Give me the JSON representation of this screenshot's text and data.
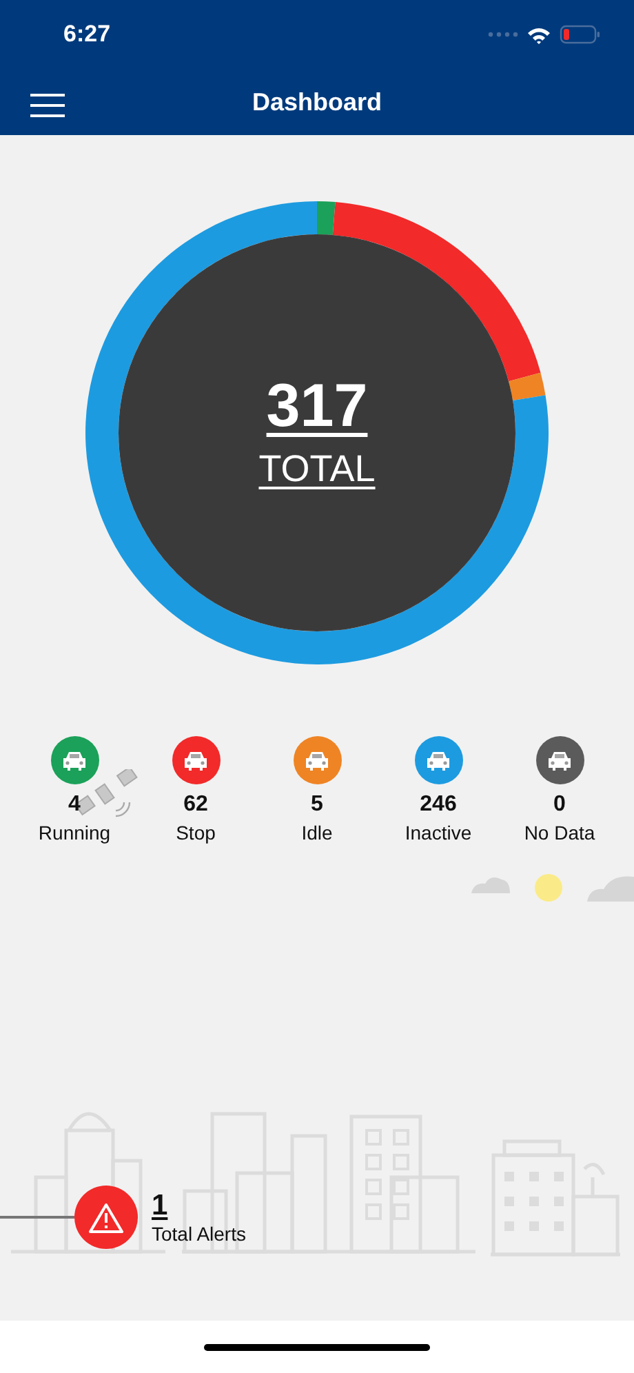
{
  "status_bar": {
    "time": "6:27"
  },
  "nav": {
    "title": "Dashboard"
  },
  "summary": {
    "total": "317",
    "total_label": "TOTAL"
  },
  "statuses": [
    {
      "count": "4",
      "label": "Running",
      "color": "#1ba159"
    },
    {
      "count": "62",
      "label": "Stop",
      "color": "#f22a2a"
    },
    {
      "count": "5",
      "label": "Idle",
      "color": "#ef8424"
    },
    {
      "count": "246",
      "label": "Inactive",
      "color": "#1d9be0"
    },
    {
      "count": "0",
      "label": "No Data",
      "color": "#5b5b5b"
    }
  ],
  "alerts": {
    "count": "1",
    "label": "Total Alerts"
  }
}
